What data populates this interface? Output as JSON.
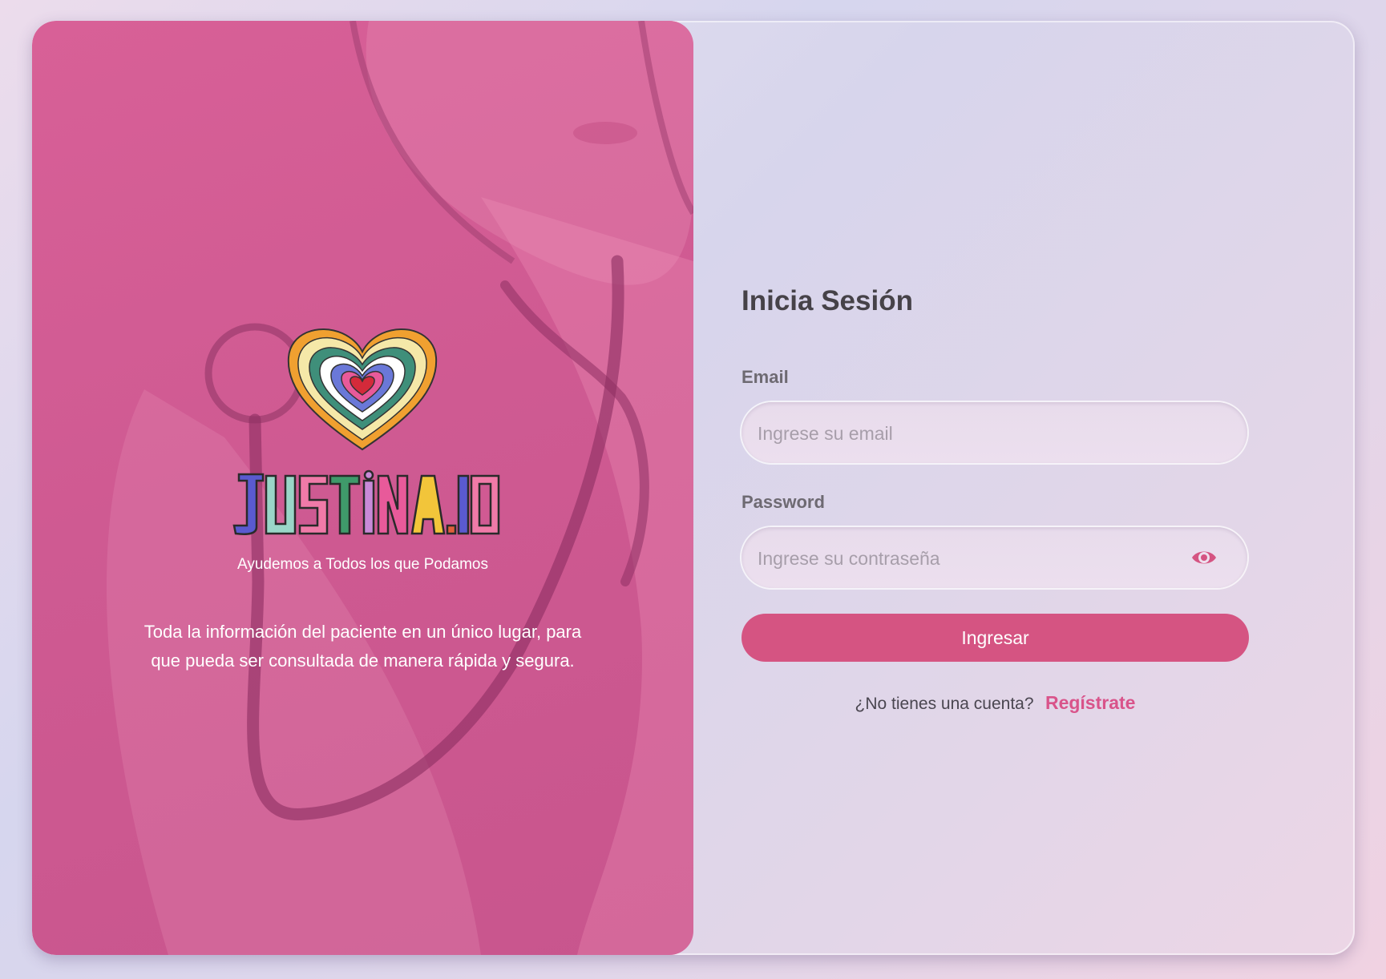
{
  "brand": {
    "name": "JUSTINA.IO",
    "tagline": "Ayudemos a Todos los que Podamos",
    "description": "Toda la información del paciente en un único lugar, para que pueda ser consultada de manera rápida y segura."
  },
  "login": {
    "title": "Inicia Sesión",
    "email_label": "Email",
    "email_placeholder": "Ingrese su email",
    "password_label": "Password",
    "password_placeholder": "Ingrese su contraseña",
    "submit_label": "Ingresar",
    "signup_question": "¿No tienes una cuenta?",
    "signup_link": "Regístrate"
  },
  "icons": {
    "password_toggle": "eye-icon",
    "logo": "heart-mandala-logo"
  },
  "colors": {
    "accent": "#d55482",
    "link": "#d9538a",
    "left_panel": "#d05a93"
  }
}
